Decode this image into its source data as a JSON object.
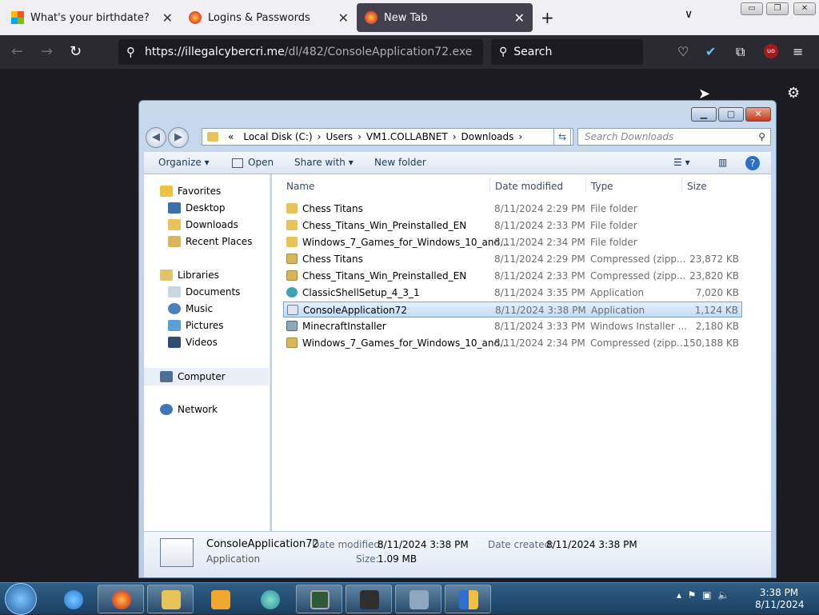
{
  "browser": {
    "tabs": [
      {
        "title": "What's your birthdate?",
        "icon": "windows-logo-icon"
      },
      {
        "title": "Logins & Passwords",
        "icon": "firefox-icon"
      },
      {
        "title": "New Tab",
        "icon": "firefox-icon"
      }
    ],
    "url_domain": "https://illegalcybercri.me",
    "url_path": "/dl/482/ConsoleApplication72.exe",
    "search_placeholder": "Search"
  },
  "explorer": {
    "breadcrumb": [
      "«",
      "Local Disk (C:)",
      "Users",
      "VM1.COLLABNET",
      "Downloads"
    ],
    "search_placeholder": "Search Downloads",
    "toolbar": {
      "organize": "Organize ▾",
      "open": "Open",
      "share": "Share with ▾",
      "new_folder": "New folder"
    },
    "nav": {
      "favorites": "Favorites",
      "desktop": "Desktop",
      "downloads": "Downloads",
      "recent": "Recent Places",
      "libraries": "Libraries",
      "documents": "Documents",
      "music": "Music",
      "pictures": "Pictures",
      "videos": "Videos",
      "computer": "Computer",
      "network": "Network"
    },
    "columns": {
      "name": "Name",
      "date": "Date modified",
      "type": "Type",
      "size": "Size"
    },
    "files": [
      {
        "name": "Chess Titans",
        "date": "8/11/2024 2:29 PM",
        "type": "File folder",
        "size": ""
      },
      {
        "name": "Chess_Titans_Win_Preinstalled_EN",
        "date": "8/11/2024 2:33 PM",
        "type": "File folder",
        "size": ""
      },
      {
        "name": "Windows_7_Games_for_Windows_10_and...",
        "date": "8/11/2024 2:34 PM",
        "type": "File folder",
        "size": ""
      },
      {
        "name": "Chess Titans",
        "date": "8/11/2024 2:29 PM",
        "type": "Compressed (zipp...",
        "size": "23,872 KB"
      },
      {
        "name": "Chess_Titans_Win_Preinstalled_EN",
        "date": "8/11/2024 2:33 PM",
        "type": "Compressed (zipp...",
        "size": "23,820 KB"
      },
      {
        "name": "ClassicShellSetup_4_3_1",
        "date": "8/11/2024 3:35 PM",
        "type": "Application",
        "size": "7,020 KB"
      },
      {
        "name": "ConsoleApplication72",
        "date": "8/11/2024 3:38 PM",
        "type": "Application",
        "size": "1,124 KB"
      },
      {
        "name": "MinecraftInstaller",
        "date": "8/11/2024 3:33 PM",
        "type": "Windows Installer ...",
        "size": "2,180 KB"
      },
      {
        "name": "Windows_7_Games_for_Windows_10_and...",
        "date": "8/11/2024 2:34 PM",
        "type": "Compressed (zipp...",
        "size": "150,188 KB"
      }
    ],
    "details": {
      "name": "ConsoleApplication72",
      "type": "Application",
      "date_modified_label": "Date modified:",
      "date_modified": "8/11/2024 3:38 PM",
      "size_label": "Size:",
      "size": "1.09 MB",
      "date_created_label": "Date created:",
      "date_created": "8/11/2024 3:38 PM"
    }
  },
  "taskbar": {
    "time": "3:38 PM",
    "date": "8/11/2024"
  },
  "colors": {
    "browser_dark": "#2b2a33",
    "selection": "#c4dcf6",
    "taskbar": "#1b3f61"
  }
}
